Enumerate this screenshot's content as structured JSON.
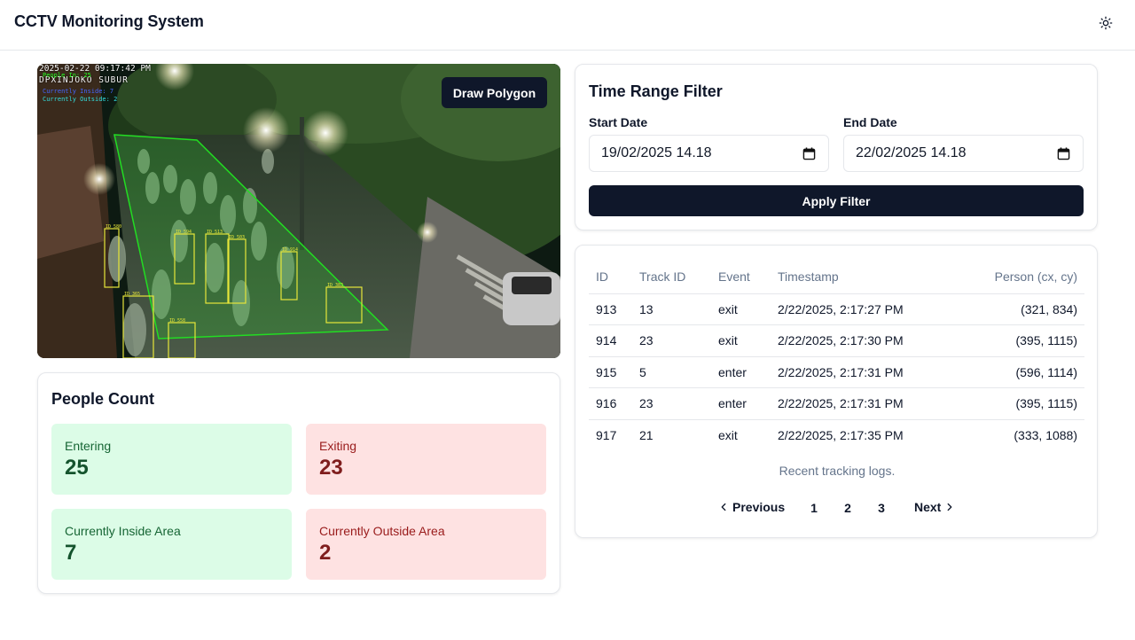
{
  "header": {
    "title": "CCTV Monitoring System",
    "theme_icon": "sun-icon"
  },
  "video": {
    "timestamp": "2025-02-22 09:17:42 PM",
    "location": "DPXINJOKO SUBUR",
    "overlay_lines": [
      {
        "text": "People In: 25",
        "color": "#22ff22"
      },
      {
        "text": "Currently Inside: 7",
        "color": "#4466ff"
      },
      {
        "text": "Currently Outside: 2",
        "color": "#33dddd"
      }
    ],
    "polygon_color": "#22dd22",
    "box_color": "#e6e63a",
    "box_labels": [
      "ID 580",
      "ID 594",
      "ID 513",
      "ID 503",
      "ID 914",
      "ID 365",
      "ID 558",
      "ID 383"
    ],
    "draw_button_label": "Draw Polygon"
  },
  "people_count": {
    "title": "People Count",
    "entering": {
      "label": "Entering",
      "value": "25"
    },
    "exiting": {
      "label": "Exiting",
      "value": "23"
    },
    "inside": {
      "label": "Currently Inside Area",
      "value": "7"
    },
    "outside": {
      "label": "Currently Outside Area",
      "value": "2"
    }
  },
  "filter": {
    "title": "Time Range Filter",
    "start_label": "Start Date",
    "start_value": "19/02/2025 14.18",
    "end_label": "End Date",
    "end_value": "22/02/2025 14.18",
    "apply_label": "Apply Filter",
    "calendar_icon": "calendar-icon"
  },
  "logs": {
    "columns": [
      "ID",
      "Track ID",
      "Event",
      "Timestamp",
      "Person (cx, cy)"
    ],
    "rows": [
      [
        "913",
        "13",
        "exit",
        "2/22/2025, 2:17:27 PM",
        "(321, 834)"
      ],
      [
        "914",
        "23",
        "exit",
        "2/22/2025, 2:17:30 PM",
        "(395, 1115)"
      ],
      [
        "915",
        "5",
        "enter",
        "2/22/2025, 2:17:31 PM",
        "(596, 1114)"
      ],
      [
        "916",
        "23",
        "enter",
        "2/22/2025, 2:17:31 PM",
        "(395, 1115)"
      ],
      [
        "917",
        "21",
        "exit",
        "2/22/2025, 2:17:35 PM",
        "(333, 1088)"
      ]
    ],
    "caption": "Recent tracking logs.",
    "pagination": {
      "previous": "Previous",
      "next": "Next",
      "pages": [
        "1",
        "2",
        "3"
      ],
      "current": "1"
    }
  }
}
